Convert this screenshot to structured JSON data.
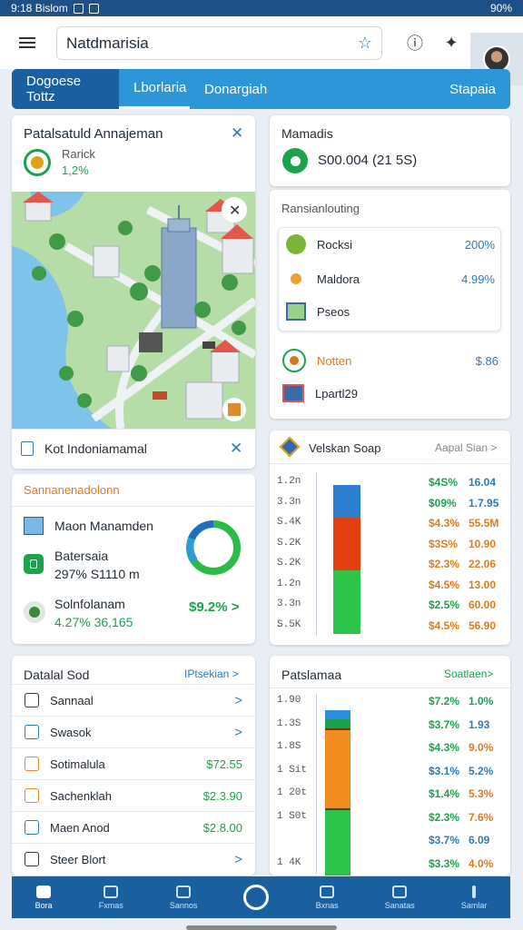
{
  "status": {
    "time": "9:18 Bislom",
    "right": "90%"
  },
  "search": {
    "value": "Natdmarisia"
  },
  "tabs": [
    "Dogoese Tottz",
    "Lborlaria",
    "Donargiah",
    "Stapaia"
  ],
  "card1": {
    "title": "Patalsatuld Annajeman",
    "sub1": "Rarick",
    "sub2": "1,2%",
    "footer": "Kot Indoniamamal"
  },
  "card2": {
    "title": "Mamadis",
    "value": "S00.004 (21 5S)",
    "section": "Ransianlouting",
    "items": [
      {
        "label": "Rocksi",
        "value": "200%"
      },
      {
        "label": "Maldora",
        "value": "4.99%"
      },
      {
        "label": "Pseos",
        "value": ""
      }
    ],
    "item4": {
      "label": "Notten",
      "value": "$.86"
    },
    "item5": {
      "label": "Lpartl29",
      "value": ""
    }
  },
  "card3": {
    "title": "Sannanenadolonn",
    "row1": "Maon Manamden",
    "row2a": "Batersaia",
    "row2b": "297%  S1110 m",
    "row3a": "Solnfolanam",
    "row3b": "4.27%  36,165",
    "row3v": "$9.2% >"
  },
  "card4": {
    "title": "Velskan Soap",
    "link": "Aapal Sian >",
    "axis": [
      "1.2n",
      "3.3n",
      "S.4K",
      "S.2K",
      "S.2K",
      "1.2n",
      "3.3n",
      "S.5K"
    ],
    "col1": [
      "$4S%",
      "$09%",
      "$4.3%",
      "$3S%",
      "$2.3%",
      "$4.5%",
      "$2.5%",
      "$4.5%"
    ],
    "col2": [
      "16.04",
      "1.7.95",
      "55.5M",
      "10.90",
      "22.06",
      "13.00",
      "60.00",
      "56.90"
    ]
  },
  "card5": {
    "title": "Datalal Sod",
    "link": "IPtsekian >",
    "rows": [
      {
        "label": "Sannaal",
        "value": ">"
      },
      {
        "label": "Swasok",
        "value": ">"
      },
      {
        "label": "Sotimalula",
        "value": "$72.55"
      },
      {
        "label": "Sachenklah",
        "value": "$2.3.90"
      },
      {
        "label": "Maen Anod",
        "value": "$2.8.00"
      },
      {
        "label": "Steer Blort",
        "value": ">"
      }
    ]
  },
  "card6": {
    "title": "Patslamaa",
    "link": "Soatlaen>",
    "axis": [
      "1.90",
      "1.3S",
      "1.8S",
      "1 Sit",
      "1 20t",
      "1 S0t",
      "",
      "1 4K"
    ],
    "col1": [
      "$7.2%",
      "$3.7%",
      "$4.3%",
      "$3.1%",
      "$1.4%",
      "$2.3%",
      "$3.7%",
      "$3.3%"
    ],
    "col2": [
      "1.0%",
      "1.93",
      "9.0%",
      "5.2%",
      "5.3%",
      "7.6%",
      "6.09",
      "4.0%"
    ]
  },
  "nav": [
    "Bora",
    "Fxmas",
    "Sannos",
    "",
    "Bxnas",
    "Sanatas",
    "Samlar"
  ],
  "colors": {
    "primary": "#1a5fa0",
    "accent": "#2d96d8",
    "green": "#1aa34a",
    "orange": "#e07b1a",
    "red": "#e2410f",
    "blue": "#2b7bc0"
  }
}
